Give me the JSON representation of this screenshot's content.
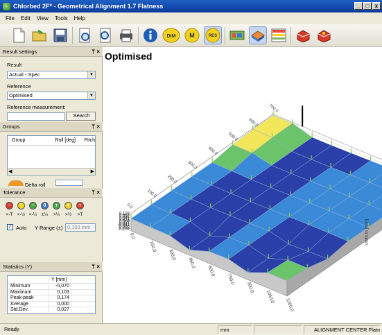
{
  "window": {
    "title": "Chlorbed 2F* - Geometrical Alignment 1.7 Flatness",
    "min_label": "_",
    "max_label": "□",
    "close_label": "x"
  },
  "menu": [
    "File",
    "Edit",
    "View",
    "Tools",
    "Help"
  ],
  "toolbar": {
    "dim_label": "DIM",
    "m_label": "M",
    "res_label": "RES"
  },
  "result_settings": {
    "header": "Result settings",
    "result_label": "Result",
    "result_value": "Actual - Spec",
    "reference_label": "Reference",
    "reference_value": "Optimised",
    "refmeas_label": "Reference measurement:",
    "refmeas_value": "",
    "search_label": "Search"
  },
  "groups": {
    "header": "Groups",
    "columns": [
      "Group",
      "Roll [deg]",
      "Pitch"
    ],
    "delta_roll_label": "Delta roll",
    "delta_roll_value": "---"
  },
  "tolerance": {
    "header": "Tolerance",
    "symbols": [
      "−",
      "−",
      "−",
      "0",
      "+",
      "+",
      "+"
    ],
    "labels": [
      "<-T",
      "<-½",
      "<-¼",
      "±¼",
      ">¼",
      ">½",
      ">T"
    ],
    "colors": [
      "#d63a2a",
      "#f2d21c",
      "#47a847",
      "#3a78c8",
      "#47a847",
      "#f2d21c",
      "#d63a2a"
    ],
    "auto_label": "Auto",
    "yrange_label": "Y Range (±)",
    "yrange_value": "0,103 mm"
  },
  "statistics": {
    "header": "Statistics (Y)",
    "column": "Y [mm]",
    "rows": [
      {
        "label": "Minimum",
        "value": "-0,070"
      },
      {
        "label": "Maximum",
        "value": "0,103"
      },
      {
        "label": "Peak-peak",
        "value": "0,174"
      },
      {
        "label": "Average",
        "value": "0,000"
      },
      {
        "label": "Std.Dev.",
        "value": "0,027"
      }
    ]
  },
  "plot": {
    "title": "Optimised",
    "z_axis_label": "Units in [mm]",
    "z_ticks": [
      "0,103",
      "0,082",
      "0,062",
      "0,041",
      "0,021",
      "0,000",
      "-0,021",
      "-0,041",
      "-0,062",
      "-0,082",
      "-0,102"
    ],
    "x_ticks": [
      "0,0",
      "150,0",
      "300,0",
      "450,0",
      "600,0",
      "750,0",
      "900,0",
      "1050,0",
      "1200,0"
    ],
    "y_ticks": [
      "0,0",
      "100,0",
      "200,0",
      "300,0",
      "400,0",
      "500,0",
      "600,0",
      "700,0"
    ]
  },
  "status": {
    "ready": "Ready",
    "unit": "mm",
    "company": "ALIGNMENT CENTER Flatne"
  }
}
